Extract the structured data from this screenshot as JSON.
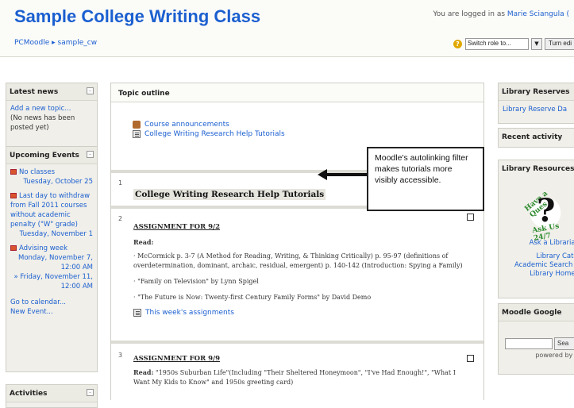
{
  "header": {
    "site_title": "Sample College Writing Class",
    "login_prefix": "You are logged in as ",
    "login_user": "Marie Sciangula (",
    "breadcrumb_root": "PCMoodle",
    "breadcrumb_sep": "▸",
    "breadcrumb_course": "sample_cw",
    "role_select": "Switch role to...",
    "turn_editing": "Turn edi"
  },
  "left": {
    "latest_news": {
      "title": "Latest news",
      "add_topic": "Add a new topic...",
      "no_news": "(No news has been posted yet)"
    },
    "upcoming": {
      "title": "Upcoming Events",
      "events": [
        {
          "title": "No classes",
          "date": "Tuesday, October 25"
        },
        {
          "title": "Last day to withdraw from Fall 2011 courses without academic penalty (\"W\" grade)",
          "date": "Tuesday, November 1"
        },
        {
          "title": "Advising week",
          "date": "Monday, November 7, 12:00 AM"
        },
        {
          "title": "» Friday, November 11, 12:00 AM",
          "date": ""
        }
      ],
      "go_calendar": "Go to calendar...",
      "new_event": "New Event..."
    },
    "activities": {
      "title": "Activities"
    }
  },
  "main": {
    "title": "Topic outline",
    "section0": {
      "links": [
        "Course announcements",
        "College Writing Research Help Tutorials"
      ]
    },
    "section1": {
      "num": "1",
      "heading": "College Writing Research Help Tutorials"
    },
    "section2": {
      "num": "2",
      "title": "ASSIGNMENT FOR 9/2",
      "read": "Read:",
      "items": [
        "· McCormick p. 3-7 (A Method for Reading, Writing, & Thinking Critically) p. 95-97 (definitions of overdetermination, dominant, archaic, residual, emergent) p. 140-142 (Introduction: Spying a Family)",
        "· \"Family on Television\" by Lynn Spigel",
        "· \"The Future is Now: Twenty-first Century Family Forms\" by David Demo"
      ],
      "link": "This week's assignments"
    },
    "section3": {
      "num": "3",
      "title": "ASSIGNMENT FOR 9/9",
      "read_prefix": "Read:",
      "read_text": " \"1950s Suburban Life\"(Including \"Their Sheltered Honeymoon\", \"I've Had Enough!\", \"What I Want My Kids to Know\" and 1950s greeting card)"
    }
  },
  "callout": {
    "text": "Moodle's autolinking filter makes tutorials more visibly accessible."
  },
  "right": {
    "reserves": {
      "title": "Library Reserves",
      "link": "Library Reserve Da"
    },
    "recent": {
      "title": "Recent activity"
    },
    "resources": {
      "title": "Library Resources",
      "badge_top": "Have a Ques",
      "badge_bottom": "Ask Us 24/7",
      "badge_q": "?",
      "ask": "Ask a Librarian",
      "catalog": "Library Catal",
      "academic": "Academic Search C",
      "homepage": "Library Homep"
    },
    "google": {
      "title": "Moodle Google",
      "search": "Sea",
      "powered": "powered by G"
    }
  }
}
